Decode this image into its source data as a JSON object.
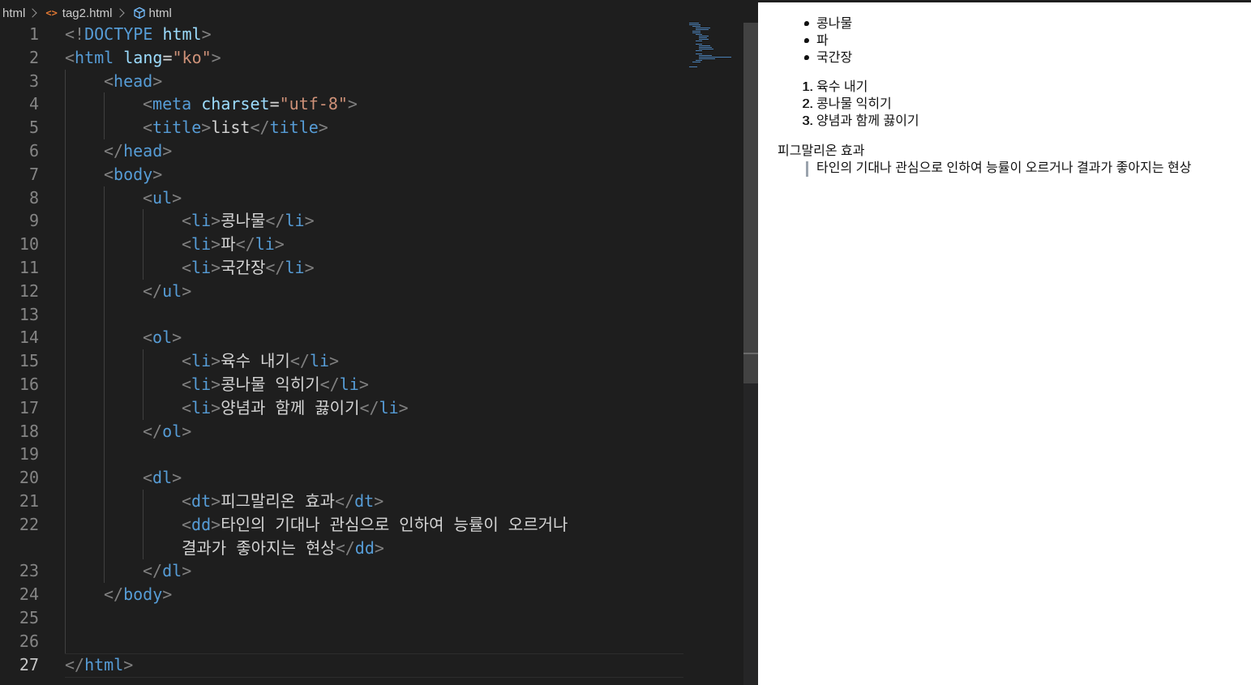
{
  "breadcrumb": {
    "folder": "html",
    "file": "tag2.html",
    "element": "html"
  },
  "editor": {
    "active_line": 27,
    "lines": [
      {
        "n": "1",
        "tokens": [
          [
            "ang",
            "<!"
          ],
          [
            "tag",
            "DOCTYPE"
          ],
          [
            "plain",
            " "
          ],
          [
            "attr",
            "html"
          ],
          [
            "ang",
            ">"
          ]
        ],
        "indent": 0
      },
      {
        "n": "2",
        "tokens": [
          [
            "ang",
            "<"
          ],
          [
            "tag",
            "html"
          ],
          [
            "plain",
            " "
          ],
          [
            "attr",
            "lang"
          ],
          [
            "plain",
            "="
          ],
          [
            "str",
            "\"ko\""
          ],
          [
            "ang",
            ">"
          ]
        ],
        "indent": 0
      },
      {
        "n": "3",
        "tokens": [
          [
            "ang",
            "<"
          ],
          [
            "tag",
            "head"
          ],
          [
            "ang",
            ">"
          ]
        ],
        "indent": 1
      },
      {
        "n": "4",
        "tokens": [
          [
            "ang",
            "<"
          ],
          [
            "tag",
            "meta"
          ],
          [
            "plain",
            " "
          ],
          [
            "attr",
            "charset"
          ],
          [
            "plain",
            "="
          ],
          [
            "str",
            "\"utf-8\""
          ],
          [
            "ang",
            ">"
          ]
        ],
        "indent": 2
      },
      {
        "n": "5",
        "tokens": [
          [
            "ang",
            "<"
          ],
          [
            "tag",
            "title"
          ],
          [
            "ang",
            ">"
          ],
          [
            "plain",
            "list"
          ],
          [
            "ang",
            "</"
          ],
          [
            "tag",
            "title"
          ],
          [
            "ang",
            ">"
          ]
        ],
        "indent": 2
      },
      {
        "n": "6",
        "tokens": [
          [
            "ang",
            "</"
          ],
          [
            "tag",
            "head"
          ],
          [
            "ang",
            ">"
          ]
        ],
        "indent": 1
      },
      {
        "n": "7",
        "tokens": [
          [
            "ang",
            "<"
          ],
          [
            "tag",
            "body"
          ],
          [
            "ang",
            ">"
          ]
        ],
        "indent": 1
      },
      {
        "n": "8",
        "tokens": [
          [
            "ang",
            "<"
          ],
          [
            "tag",
            "ul"
          ],
          [
            "ang",
            ">"
          ]
        ],
        "indent": 2
      },
      {
        "n": "9",
        "tokens": [
          [
            "ang",
            "<"
          ],
          [
            "tag",
            "li"
          ],
          [
            "ang",
            ">"
          ],
          [
            "plain",
            "콩나물"
          ],
          [
            "ang",
            "</"
          ],
          [
            "tag",
            "li"
          ],
          [
            "ang",
            ">"
          ]
        ],
        "indent": 3
      },
      {
        "n": "10",
        "tokens": [
          [
            "ang",
            "<"
          ],
          [
            "tag",
            "li"
          ],
          [
            "ang",
            ">"
          ],
          [
            "plain",
            "파"
          ],
          [
            "ang",
            "</"
          ],
          [
            "tag",
            "li"
          ],
          [
            "ang",
            ">"
          ]
        ],
        "indent": 3
      },
      {
        "n": "11",
        "tokens": [
          [
            "ang",
            "<"
          ],
          [
            "tag",
            "li"
          ],
          [
            "ang",
            ">"
          ],
          [
            "plain",
            "국간장"
          ],
          [
            "ang",
            "</"
          ],
          [
            "tag",
            "li"
          ],
          [
            "ang",
            ">"
          ]
        ],
        "indent": 3
      },
      {
        "n": "12",
        "tokens": [
          [
            "ang",
            "</"
          ],
          [
            "tag",
            "ul"
          ],
          [
            "ang",
            ">"
          ]
        ],
        "indent": 2
      },
      {
        "n": "13",
        "tokens": [],
        "indent": 2
      },
      {
        "n": "14",
        "tokens": [
          [
            "ang",
            "<"
          ],
          [
            "tag",
            "ol"
          ],
          [
            "ang",
            ">"
          ]
        ],
        "indent": 2
      },
      {
        "n": "15",
        "tokens": [
          [
            "ang",
            "<"
          ],
          [
            "tag",
            "li"
          ],
          [
            "ang",
            ">"
          ],
          [
            "plain",
            "육수 내기"
          ],
          [
            "ang",
            "</"
          ],
          [
            "tag",
            "li"
          ],
          [
            "ang",
            ">"
          ]
        ],
        "indent": 3
      },
      {
        "n": "16",
        "tokens": [
          [
            "ang",
            "<"
          ],
          [
            "tag",
            "li"
          ],
          [
            "ang",
            ">"
          ],
          [
            "plain",
            "콩나물 익히기"
          ],
          [
            "ang",
            "</"
          ],
          [
            "tag",
            "li"
          ],
          [
            "ang",
            ">"
          ]
        ],
        "indent": 3
      },
      {
        "n": "17",
        "tokens": [
          [
            "ang",
            "<"
          ],
          [
            "tag",
            "li"
          ],
          [
            "ang",
            ">"
          ],
          [
            "plain",
            "양념과 함께 끓이기"
          ],
          [
            "ang",
            "</"
          ],
          [
            "tag",
            "li"
          ],
          [
            "ang",
            ">"
          ]
        ],
        "indent": 3
      },
      {
        "n": "18",
        "tokens": [
          [
            "ang",
            "</"
          ],
          [
            "tag",
            "ol"
          ],
          [
            "ang",
            ">"
          ]
        ],
        "indent": 2
      },
      {
        "n": "19",
        "tokens": [],
        "indent": 2
      },
      {
        "n": "20",
        "tokens": [
          [
            "ang",
            "<"
          ],
          [
            "tag",
            "dl"
          ],
          [
            "ang",
            ">"
          ]
        ],
        "indent": 2
      },
      {
        "n": "21",
        "tokens": [
          [
            "ang",
            "<"
          ],
          [
            "tag",
            "dt"
          ],
          [
            "ang",
            ">"
          ],
          [
            "plain",
            "피그말리온 효과"
          ],
          [
            "ang",
            "</"
          ],
          [
            "tag",
            "dt"
          ],
          [
            "ang",
            ">"
          ]
        ],
        "indent": 3
      },
      {
        "n": "22",
        "tokens": [
          [
            "ang",
            "<"
          ],
          [
            "tag",
            "dd"
          ],
          [
            "ang",
            ">"
          ],
          [
            "plain",
            "타인의 기대나 관심으로 인하여 능률이 오르거나"
          ]
        ],
        "indent": 3
      },
      {
        "n": "",
        "tokens": [
          [
            "plain",
            "결과가 좋아지는 현상"
          ],
          [
            "ang",
            "</"
          ],
          [
            "tag",
            "dd"
          ],
          [
            "ang",
            ">"
          ]
        ],
        "indent": 3
      },
      {
        "n": "23",
        "tokens": [
          [
            "ang",
            "</"
          ],
          [
            "tag",
            "dl"
          ],
          [
            "ang",
            ">"
          ]
        ],
        "indent": 2
      },
      {
        "n": "24",
        "tokens": [
          [
            "ang",
            "</"
          ],
          [
            "tag",
            "body"
          ],
          [
            "ang",
            ">"
          ]
        ],
        "indent": 1
      },
      {
        "n": "25",
        "tokens": [],
        "indent": 1
      },
      {
        "n": "26",
        "tokens": [],
        "indent": 1
      },
      {
        "n": "27",
        "tokens": [
          [
            "ang",
            "</"
          ],
          [
            "tag",
            "html"
          ],
          [
            "ang",
            ">"
          ]
        ],
        "indent": 0
      }
    ]
  },
  "preview": {
    "ul": [
      "콩나물",
      "파",
      "국간장"
    ],
    "ol": [
      "육수 내기",
      "콩나물 익히기",
      "양념과 함께 끓이기"
    ],
    "ol_markers": [
      "1.",
      "2.",
      "3."
    ],
    "dt": "피그말리온 효과",
    "dd": "타인의 기대나 관심으로 인하여 능률이 오르거나 결과가 좋아지는 현상"
  }
}
